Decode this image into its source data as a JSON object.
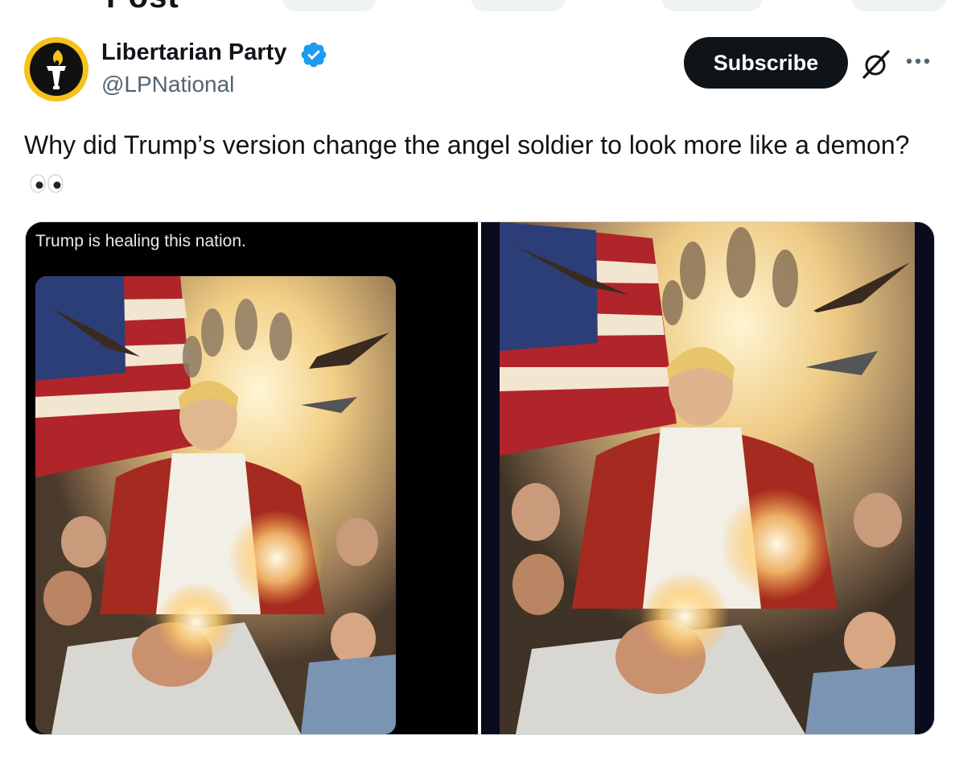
{
  "header": {
    "title": "Post"
  },
  "author": {
    "name": "Libertarian Party",
    "handle": "@LPNational",
    "verified_icon": "verified-badge-icon",
    "avatar_icon": "torch-logo-icon"
  },
  "actions": {
    "subscribe_label": "Subscribe",
    "grok_icon": "grok-icon",
    "more_icon": "more-options-icon"
  },
  "tweet": {
    "text": "Why did Trump’s version change the angel soldier to look more like a demon?",
    "emoji": "eyes-emoji"
  },
  "media": {
    "left_caption": "Trump is healing this nation.",
    "left_image": "ai-illustration-healing-scene",
    "right_image": "ai-illustration-healing-scene-alternate"
  },
  "colors": {
    "accent": "#1d9bf0",
    "subscribe_bg": "#0f1419",
    "handle_text": "#536471",
    "avatar_ring": "#f6c21c"
  }
}
